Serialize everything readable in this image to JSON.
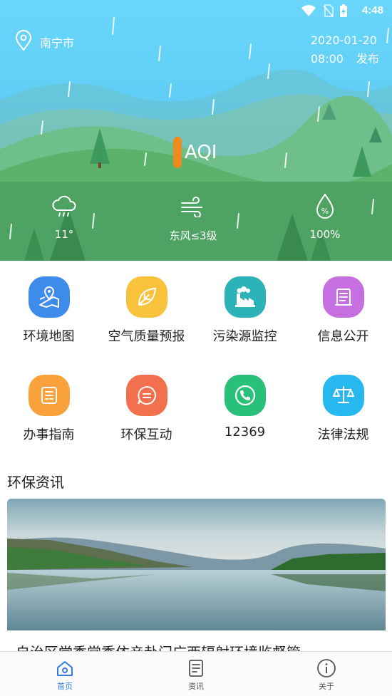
{
  "status_bar": {
    "time": "4:48",
    "icons": [
      "wifi-icon",
      "no-sim-icon",
      "battery-charging-icon"
    ]
  },
  "header": {
    "city": "南宁市",
    "publish_date": "2020-01-20",
    "publish_time": "08:00",
    "publish_label": "发布"
  },
  "aqi": {
    "label": "AQI",
    "color": "#f08a1c"
  },
  "weather": {
    "temperature": "11°",
    "wind": "东风≤3级",
    "humidity": "100%"
  },
  "grid": {
    "items": [
      {
        "label": "环境地图",
        "icon": "map-icon",
        "color": "#3d8bea"
      },
      {
        "label": "空气质量预报",
        "icon": "leaf-icon",
        "color": "#f8c33b"
      },
      {
        "label": "污染源监控",
        "icon": "factory-icon",
        "color": "#2bb3b7"
      },
      {
        "label": "信息公开",
        "icon": "document-icon",
        "color": "#c66fe0"
      },
      {
        "label": "办事指南",
        "icon": "guide-icon",
        "color": "#f9a13b"
      },
      {
        "label": "环保互动",
        "icon": "chat-icon",
        "color": "#f2704d"
      },
      {
        "label": "12369",
        "icon": "phone-icon",
        "color": "#29c07a"
      },
      {
        "label": "法律法规",
        "icon": "scale-icon",
        "color": "#27b8f0"
      }
    ]
  },
  "news": {
    "section_title": "环保资讯",
    "items": [
      {
        "title": "自治区党委常委依亲赴门广西辐射环境监督管"
      }
    ]
  },
  "bottom_nav": {
    "items": [
      {
        "label": "首页",
        "icon": "home-icon",
        "active": true
      },
      {
        "label": "资讯",
        "icon": "news-icon",
        "active": false
      },
      {
        "label": "关于",
        "icon": "info-icon",
        "active": false
      }
    ]
  }
}
